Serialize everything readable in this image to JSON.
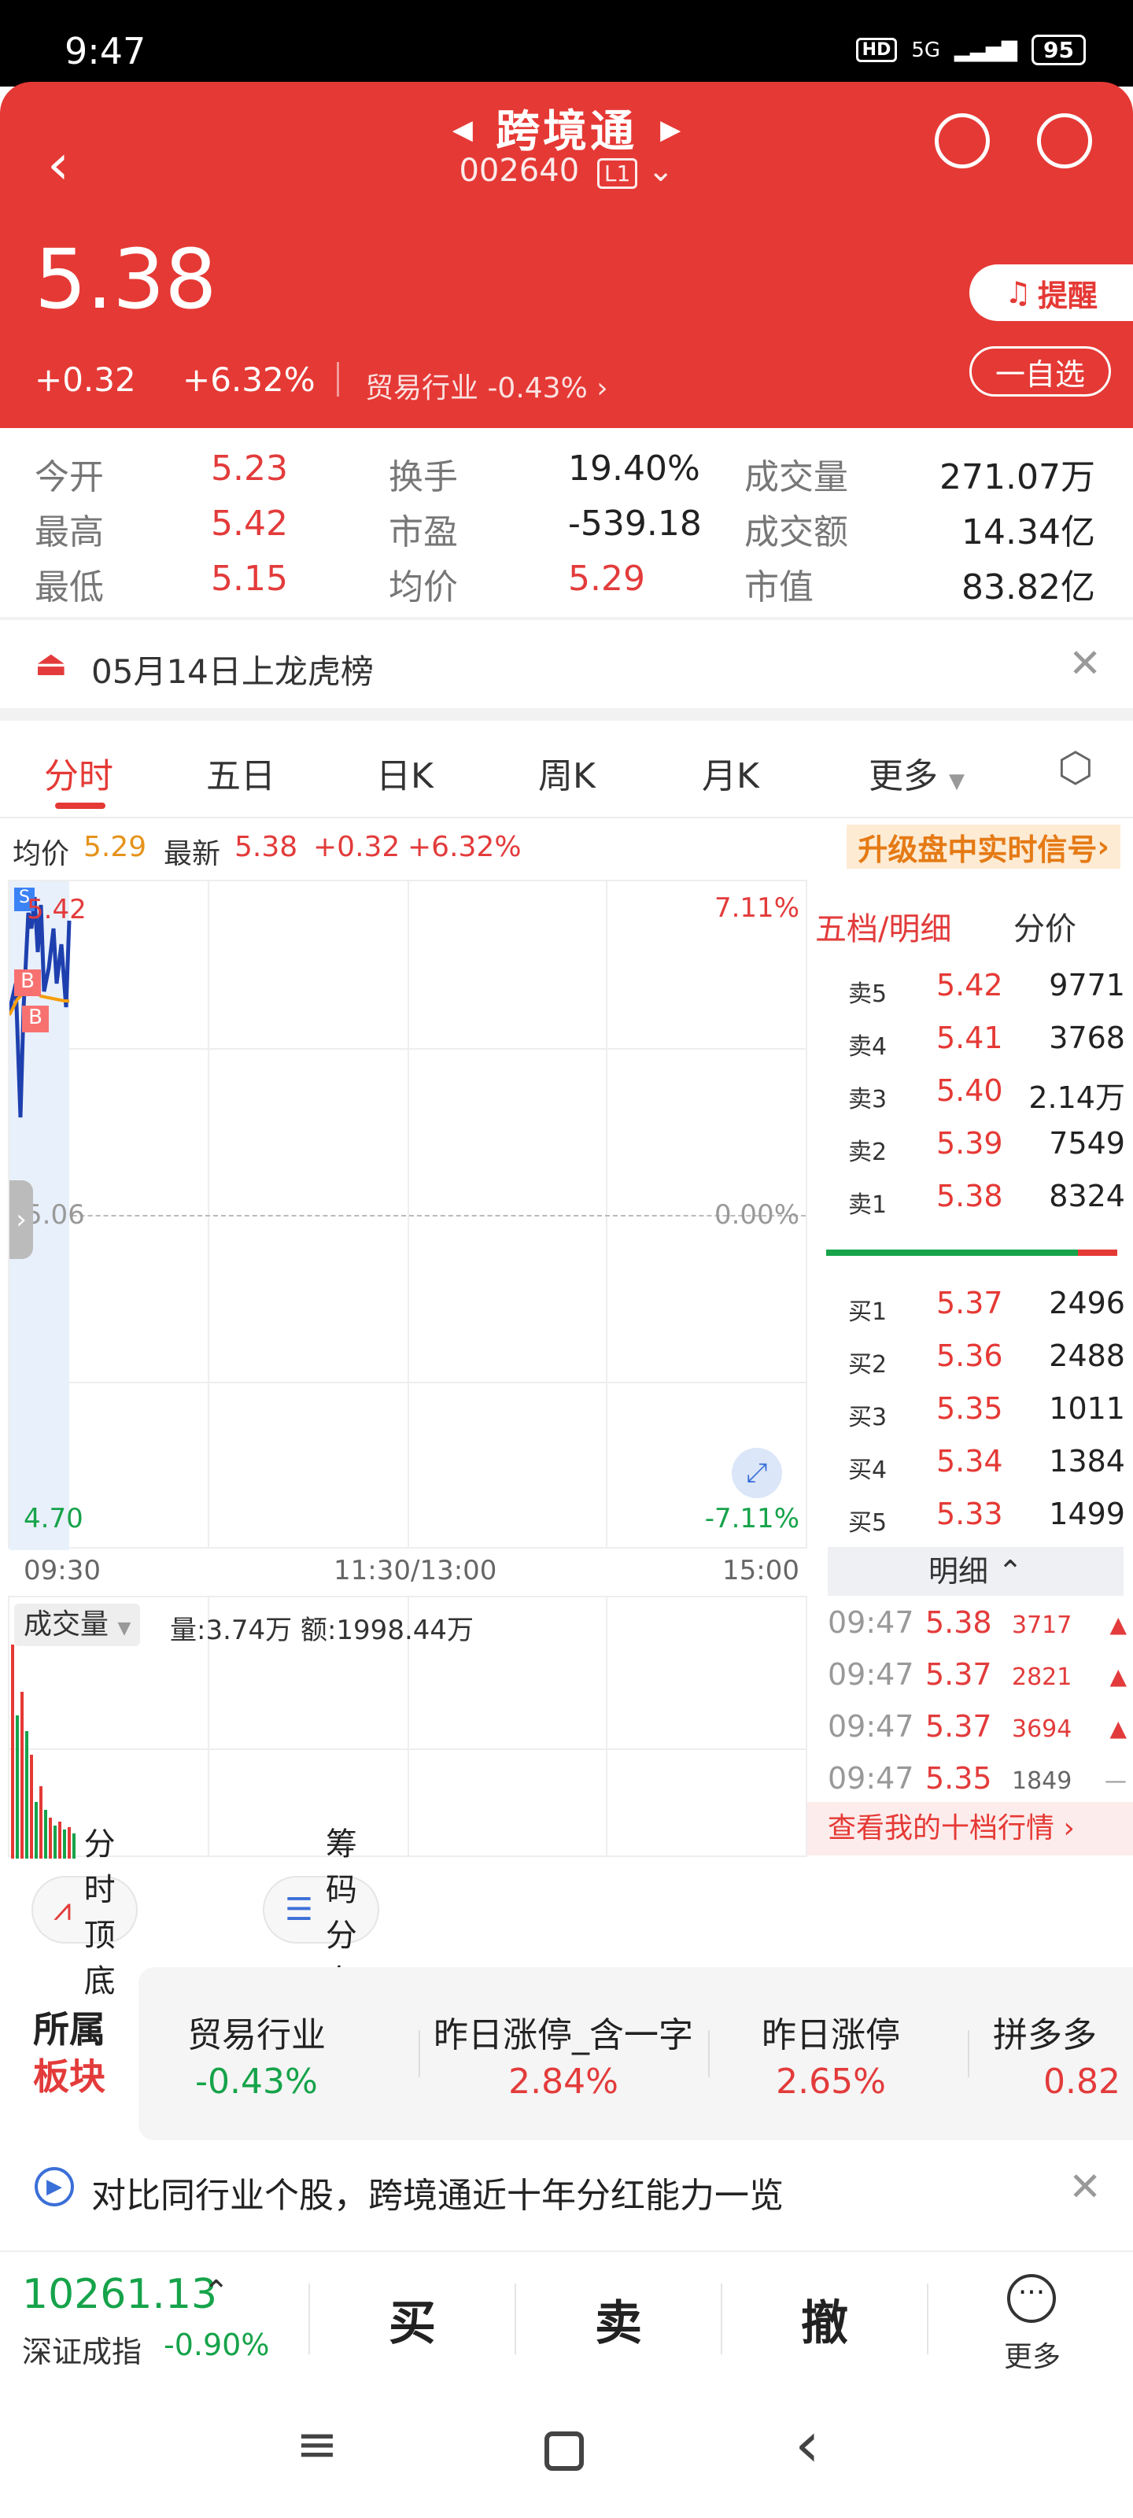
{
  "status": {
    "time": "9:47",
    "hd": "HD",
    "net": "5G",
    "battery": "95"
  },
  "header": {
    "title": "跨境通",
    "code": "002640",
    "level": "L1",
    "price": "5.38",
    "change": "+0.32",
    "change_pct": "+6.32%",
    "industry": "贸易行业 -0.43%",
    "remind": "提醒",
    "add_fav": "一自选"
  },
  "stats": {
    "open_label": "今开",
    "open": "5.23",
    "high_label": "最高",
    "high": "5.42",
    "low_label": "最低",
    "low": "5.15",
    "turnover_label": "换手",
    "turnover": "19.40%",
    "pe_label": "市盈",
    "pe": "-539.18",
    "avg_label": "均价",
    "avg": "5.29",
    "vol_label": "成交量",
    "vol": "271.07万",
    "amt_label": "成交额",
    "amt": "14.34亿",
    "mcap_label": "市值",
    "mcap": "83.82亿"
  },
  "notice": {
    "text": "05月14日上龙虎榜"
  },
  "tabs": [
    "分时",
    "五日",
    "日K",
    "周K",
    "月K",
    "更多"
  ],
  "info": {
    "avg_label": "均价",
    "avg": "5.29",
    "latest_label": "最新",
    "latest": "5.38",
    "chg": "+0.32",
    "chg_pct": "+6.32%",
    "upgrade": "升级盘中实时信号"
  },
  "chart": {
    "top_price": "5.42",
    "top_pct": "7.11%",
    "mid_price": "5.06",
    "mid_pct": "0.00%",
    "bot_price": "4.70",
    "bot_pct": "-7.11%",
    "t_start": "09:30",
    "t_mid": "11:30/13:00",
    "t_end": "15:00"
  },
  "volume": {
    "label": "成交量",
    "info": "量:3.74万 额:1998.44万"
  },
  "orderbook": {
    "head": "五档/明细",
    "head2": "分价",
    "asks": [
      {
        "label": "卖5",
        "price": "5.42",
        "vol": "9771"
      },
      {
        "label": "卖4",
        "price": "5.41",
        "vol": "3768"
      },
      {
        "label": "卖3",
        "price": "5.40",
        "vol": "2.14万"
      },
      {
        "label": "卖2",
        "price": "5.39",
        "vol": "7549"
      },
      {
        "label": "卖1",
        "price": "5.38",
        "vol": "8324"
      }
    ],
    "bids": [
      {
        "label": "买1",
        "price": "5.37",
        "vol": "2496"
      },
      {
        "label": "买2",
        "price": "5.36",
        "vol": "2488"
      },
      {
        "label": "买3",
        "price": "5.35",
        "vol": "1011"
      },
      {
        "label": "买4",
        "price": "5.34",
        "vol": "1384"
      },
      {
        "label": "买5",
        "price": "5.33",
        "vol": "1499"
      }
    ],
    "detail_head": "明细",
    "trades": [
      {
        "time": "09:47",
        "price": "5.38",
        "vol": "3717"
      },
      {
        "time": "09:47",
        "price": "5.37",
        "vol": "2821"
      },
      {
        "time": "09:47",
        "price": "5.37",
        "vol": "3694"
      },
      {
        "time": "09:47",
        "price": "5.35",
        "vol": "1849"
      }
    ],
    "more_link": "查看我的十档行情"
  },
  "chips": {
    "c1": "分时顶底",
    "c2": "筹码分布"
  },
  "sectors": {
    "head1": "所属",
    "head2": "板块",
    "items": [
      {
        "name": "贸易行业",
        "val": "-0.43%"
      },
      {
        "name": "昨日涨停_含一字",
        "val": "2.84%"
      },
      {
        "name": "昨日涨停",
        "val": "2.65%"
      },
      {
        "name": "拼多多",
        "val": "0.82"
      }
    ]
  },
  "tip": {
    "text": "对比同行业个股，跨境通近十年分红能力一览"
  },
  "bottom": {
    "index_val": "10261.13",
    "index_name": "深证成指",
    "index_chg": "-0.90%",
    "buy": "买",
    "sell": "卖",
    "cancel": "撤",
    "more": "更多"
  }
}
